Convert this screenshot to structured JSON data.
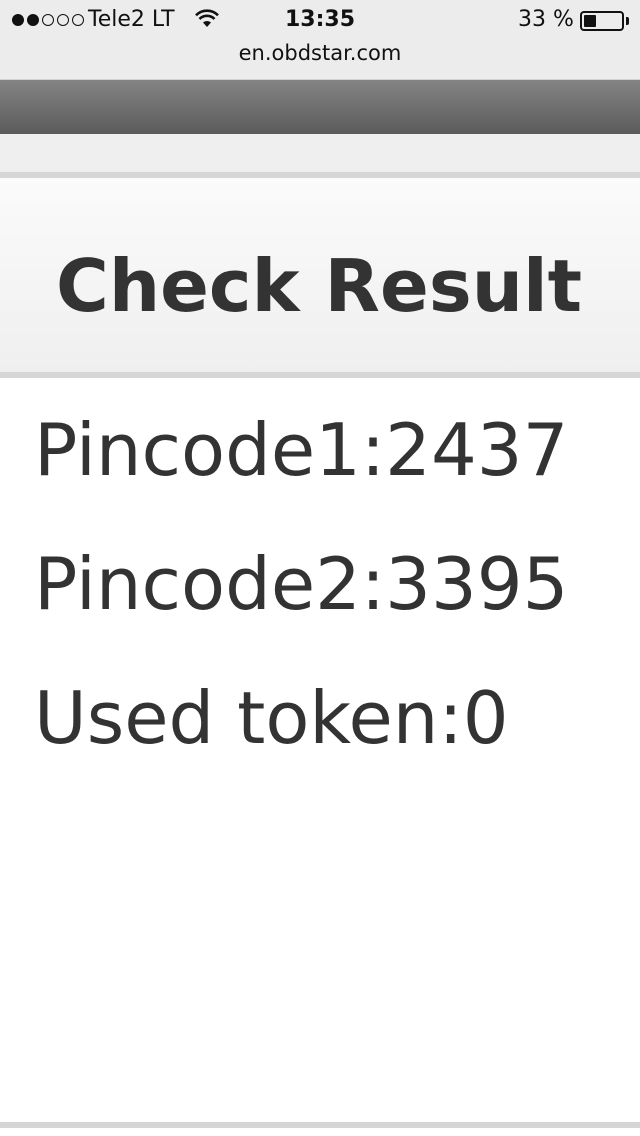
{
  "status_bar": {
    "carrier": "Tele2 LT",
    "signal_strength": 2,
    "signal_max": 5,
    "time": "13:35",
    "battery_percent": "33 %",
    "battery_level": 0.33,
    "url": "en.obdstar.com"
  },
  "page": {
    "title": "Check Result"
  },
  "results": [
    {
      "text": "Pincode1:2437"
    },
    {
      "text": "Pincode2:3395"
    },
    {
      "text": "Used token:0"
    }
  ],
  "colors": {
    "text": "#333333",
    "toolbar": "#6e6e6e",
    "divider": "#d6d6d6"
  }
}
